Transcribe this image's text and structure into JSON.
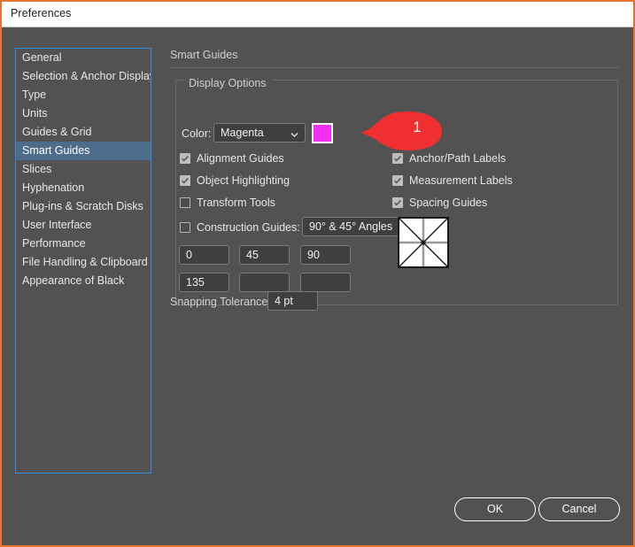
{
  "window": {
    "title": "Preferences",
    "border_color": "#e8732c",
    "background": "#525252"
  },
  "sidebar": {
    "selected": "Smart Guides",
    "focus_border_color": "#2f8fe0",
    "selection_color": "#4d6c8c",
    "items": [
      {
        "label": "General"
      },
      {
        "label": "Selection & Anchor Display"
      },
      {
        "label": "Type"
      },
      {
        "label": "Units"
      },
      {
        "label": "Guides & Grid"
      },
      {
        "label": "Smart Guides"
      },
      {
        "label": "Slices"
      },
      {
        "label": "Hyphenation"
      },
      {
        "label": "Plug-ins & Scratch Disks"
      },
      {
        "label": "User Interface"
      },
      {
        "label": "Performance"
      },
      {
        "label": "File Handling & Clipboard"
      },
      {
        "label": "Appearance of Black"
      }
    ]
  },
  "pane": {
    "title": "Smart Guides",
    "group_legend": "Display Options",
    "color_label": "Color:",
    "color_value": "Magenta",
    "color_swatch_hex": "#f22ff2",
    "checkboxes_left": [
      {
        "label": "Alignment Guides",
        "checked": true
      },
      {
        "label": "Object Highlighting",
        "checked": true
      },
      {
        "label": "Transform Tools",
        "checked": false
      }
    ],
    "checkboxes_right": [
      {
        "label": "Anchor/Path Labels",
        "checked": true
      },
      {
        "label": "Measurement Labels",
        "checked": true
      },
      {
        "label": "Spacing Guides",
        "checked": true
      }
    ],
    "construction": {
      "label": "Construction Guides:",
      "checked": false,
      "value": "90° & 45° Angles"
    },
    "angle_fields": [
      {
        "value": "0"
      },
      {
        "value": "45"
      },
      {
        "value": "90"
      },
      {
        "value": "135"
      },
      {
        "value": ""
      },
      {
        "value": ""
      }
    ],
    "snapping": {
      "label": "Snapping Tolerance:",
      "value": "4 pt"
    }
  },
  "callout": {
    "number": "1",
    "color": "#f03030"
  },
  "footer": {
    "ok_label": "OK",
    "cancel_label": "Cancel"
  }
}
